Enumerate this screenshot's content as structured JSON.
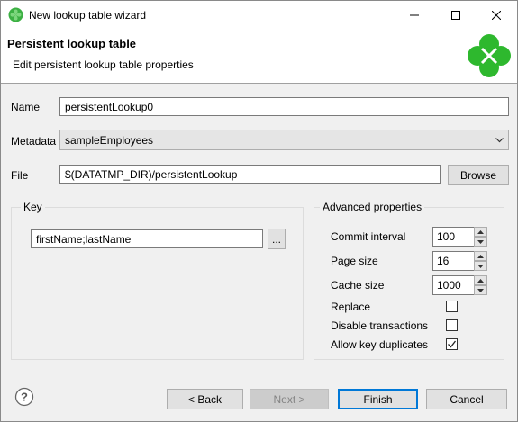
{
  "window": {
    "title": "New lookup table wizard",
    "icon": "clover-icon"
  },
  "header": {
    "title": "Persistent lookup table",
    "description": "Edit persistent lookup table properties",
    "logo": "clover-logo"
  },
  "form": {
    "name_label": "Name",
    "name_value": "persistentLookup0",
    "metadata_label": "Metadata",
    "metadata_value": "sampleEmployees",
    "file_label": "File",
    "file_value": "$(DATATMP_DIR)/persistentLookup",
    "browse_label": "Browse"
  },
  "key_group": {
    "title": "Key",
    "key_value": "firstName;lastName",
    "ellipsis_label": "..."
  },
  "advanced_group": {
    "title": "Advanced properties",
    "commit_interval_label": "Commit interval",
    "commit_interval_value": "100",
    "page_size_label": "Page size",
    "page_size_value": "16",
    "cache_size_label": "Cache size",
    "cache_size_value": "1000",
    "replace_label": "Replace",
    "replace_checked": false,
    "disable_transactions_label": "Disable transactions",
    "disable_transactions_checked": false,
    "allow_key_duplicates_label": "Allow key duplicates",
    "allow_key_duplicates_checked": true
  },
  "footer": {
    "back_label": "< Back",
    "next_label": "Next >",
    "finish_label": "Finish",
    "cancel_label": "Cancel",
    "help_icon": "help-icon"
  },
  "colors": {
    "brand_green": "#2eb82e",
    "default_button_border": "#0078d7"
  }
}
